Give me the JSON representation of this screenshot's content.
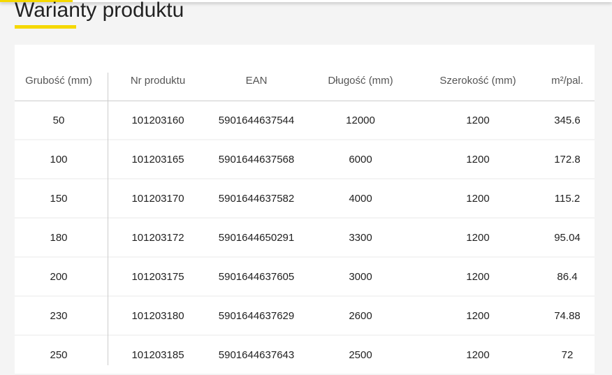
{
  "page": {
    "title": "Warianty produktu"
  },
  "table": {
    "headers": [
      "Grubość (mm)",
      "Nr produktu",
      "EAN",
      "Długość (mm)",
      "Szerokość (mm)",
      "m²/pal."
    ],
    "rows": [
      [
        "50",
        "101203160",
        "5901644637544",
        "12000",
        "1200",
        "345.6"
      ],
      [
        "100",
        "101203165",
        "5901644637568",
        "6000",
        "1200",
        "172.8"
      ],
      [
        "150",
        "101203170",
        "5901644637582",
        "4000",
        "1200",
        "115.2"
      ],
      [
        "180",
        "101203172",
        "5901644650291",
        "3300",
        "1200",
        "95.04"
      ],
      [
        "200",
        "101203175",
        "5901644637605",
        "3000",
        "1200",
        "86.4"
      ],
      [
        "230",
        "101203180",
        "5901644637629",
        "2600",
        "1200",
        "74.88"
      ],
      [
        "250",
        "101203185",
        "5901644637643",
        "2500",
        "1200",
        "72"
      ]
    ]
  },
  "colors": {
    "accent": "#f5d800",
    "background": "#f4f4f4"
  }
}
